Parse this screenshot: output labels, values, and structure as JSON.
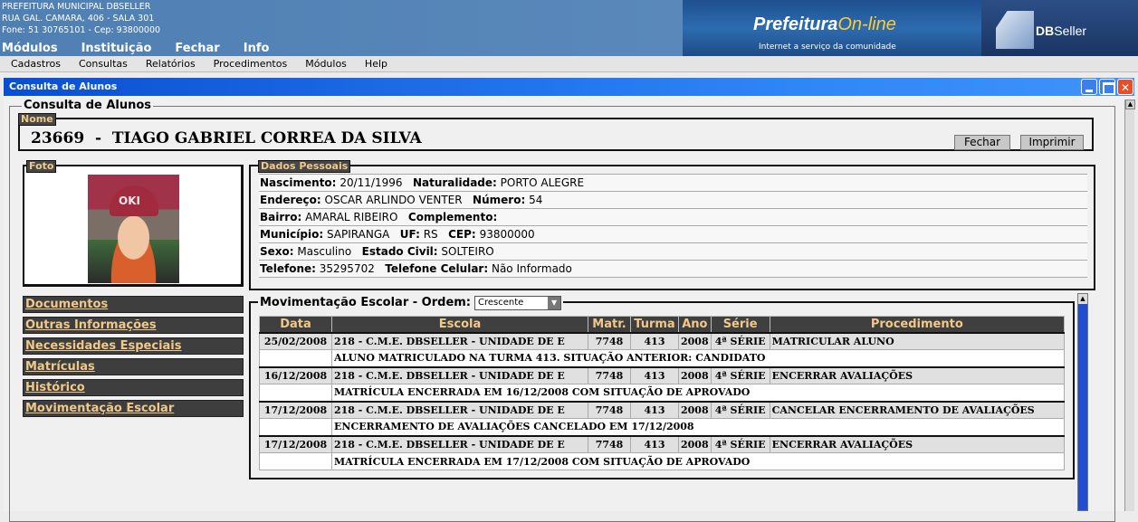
{
  "header": {
    "org_line1": "PREFEITURA MUNICIPAL DBSELLER",
    "org_line2": "RUA GAL. CAMARA, 406 - SALA 301",
    "org_line3": "Fone: 51 30765101  -  Cep: 93800000",
    "menu": [
      "Módulos",
      "Instituição",
      "Fechar",
      "Info"
    ],
    "brand_prefix": "Prefeitura",
    "brand_suffix": "On-line",
    "brand_tagline": "Internet a serviço da comunidade",
    "logo_bold": "DB",
    "logo_rest": "Seller"
  },
  "menubar": [
    "Cadastros",
    "Consultas",
    "Relatórios",
    "Procedimentos",
    "Módulos",
    "Help"
  ],
  "window": {
    "title": "Consulta de Alunos"
  },
  "form": {
    "legend": "Consulta de Alunos",
    "nome": {
      "legend": "Nome",
      "text": "23669  -  TIAGO GABRIEL CORREA DA SILVA",
      "fechar": "Fechar",
      "imprimir": "Imprimir"
    },
    "foto": {
      "legend": "Foto"
    },
    "dados": {
      "legend": "Dados Pessoais",
      "rows": [
        [
          {
            "label": "Nascimento:",
            "value": "20/11/1996"
          },
          {
            "label": "Naturalidade:",
            "value": "PORTO ALEGRE"
          }
        ],
        [
          {
            "label": "Endereço:",
            "value": "OSCAR ARLINDO VENTER"
          },
          {
            "label": "Número:",
            "value": "54"
          }
        ],
        [
          {
            "label": "Bairro:",
            "value": "AMARAL RIBEIRO"
          },
          {
            "label": "Complemento:",
            "value": ""
          }
        ],
        [
          {
            "label": "Município:",
            "value": "SAPIRANGA"
          },
          {
            "label": "UF:",
            "value": "RS"
          },
          {
            "label": "CEP:",
            "value": "93800000"
          }
        ],
        [
          {
            "label": "Sexo:",
            "value": "Masculino"
          },
          {
            "label": "Estado Civil:",
            "value": "SOLTEIRO"
          }
        ],
        [
          {
            "label": "Telefone:",
            "value": "35295702"
          },
          {
            "label": "Telefone Celular:",
            "value": "Não Informado"
          }
        ]
      ]
    },
    "links": [
      "Documentos",
      "Outras Informações",
      "Necessidades Especiais",
      "Matrículas",
      "Histórico",
      "Movimentação Escolar"
    ],
    "movimentacao": {
      "legend": "Movimentação Escolar - Ordem:",
      "ordem": "Crescente",
      "headers": [
        "Data",
        "Escola",
        "Matr.",
        "Turma",
        "Ano",
        "Série",
        "Procedimento"
      ],
      "rows": [
        {
          "data": "25/02/2008",
          "escola": "218 - C.M.E. DBSELLER - UNIDADE DE E",
          "matr": "7748",
          "turma": "413",
          "ano": "2008",
          "serie": "4ª SÉRIE",
          "proc": "MATRICULAR ALUNO",
          "obs": "ALUNO MATRICULADO NA TURMA 413. SITUAÇÃO ANTERIOR: CANDIDATO"
        },
        {
          "data": "16/12/2008",
          "escola": "218 - C.M.E. DBSELLER - UNIDADE DE E",
          "matr": "7748",
          "turma": "413",
          "ano": "2008",
          "serie": "4ª SÉRIE",
          "proc": "ENCERRAR AVALIAÇÕES",
          "obs": "MATRÍCULA ENCERRADA EM 16/12/2008 COM SITUAÇÃO DE APROVADO"
        },
        {
          "data": "17/12/2008",
          "escola": "218 - C.M.E. DBSELLER - UNIDADE DE E",
          "matr": "7748",
          "turma": "413",
          "ano": "2008",
          "serie": "4ª SÉRIE",
          "proc": "CANCELAR ENCERRAMENTO DE AVALIAÇÕES",
          "obs": "ENCERRAMENTO DE AVALIAÇÕES CANCELADO EM 17/12/2008"
        },
        {
          "data": "17/12/2008",
          "escola": "218 - C.M.E. DBSELLER - UNIDADE DE E",
          "matr": "7748",
          "turma": "413",
          "ano": "2008",
          "serie": "4ª SÉRIE",
          "proc": "ENCERRAR AVALIAÇÕES",
          "obs": "MATRÍCULA ENCERRADA EM 17/12/2008 COM SITUAÇÃO DE APROVADO"
        }
      ]
    }
  }
}
